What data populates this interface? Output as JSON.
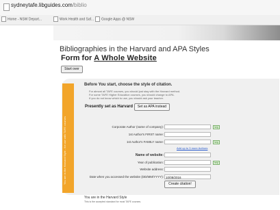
{
  "browser": {
    "url_domain": "sydneytafe.libguides.com",
    "url_path": "/biblio",
    "bookmarks": [
      "Home - NSW Depart...",
      "Work Health and Saf...",
      "Google Apps @ NSW"
    ]
  },
  "page": {
    "heading": "Bibliographies in the Harvard and APA Styles",
    "form_title_prefix": "Form for ",
    "form_title_link": "A Whole Website",
    "start_over": "Start over"
  },
  "sidebar": {
    "text": "You are in the Harvard Style - for use with TAFE courses"
  },
  "form": {
    "before_title": "Before You start, choose the style of citation.",
    "info_lines": [
      "For almost all TAFE courses, you should just stay with the Harvard method.",
      "For some TAFE Higher Education courses, you should change to APA.",
      "If you do not know which to use, you should ask your teacher."
    ],
    "presently_label": "Presently set as Harvard :",
    "set_apa_button": "Set as APA instead",
    "help_label": "help",
    "fields": [
      {
        "label": "Corporate Author (name of company):",
        "value": "",
        "bold": false,
        "help": true
      },
      {
        "label": "1st Author's FIRST name:",
        "value": "",
        "bold": false,
        "help": false
      },
      {
        "label": "1st Author's FAMILY name:",
        "value": "",
        "bold": false,
        "help": true
      },
      {
        "label": "Name of website:",
        "value": "",
        "bold": true,
        "help": false
      },
      {
        "label": "Year of publication:",
        "value": "",
        "bold": false,
        "help": true
      },
      {
        "label": "Website address:",
        "value": "",
        "bold": false,
        "help": false
      },
      {
        "label": "Date when you accessed the website (DD/MM/YYYY):",
        "value": "10/08/2016",
        "bold": false,
        "help": false
      }
    ],
    "add_authors_link": "Add up to 3 more Authors",
    "create_button": "Create citation!"
  },
  "footer": {
    "style_note": "You are in the Harvard Style",
    "style_sub": "This is the accepted standard for most TAFE courses."
  }
}
